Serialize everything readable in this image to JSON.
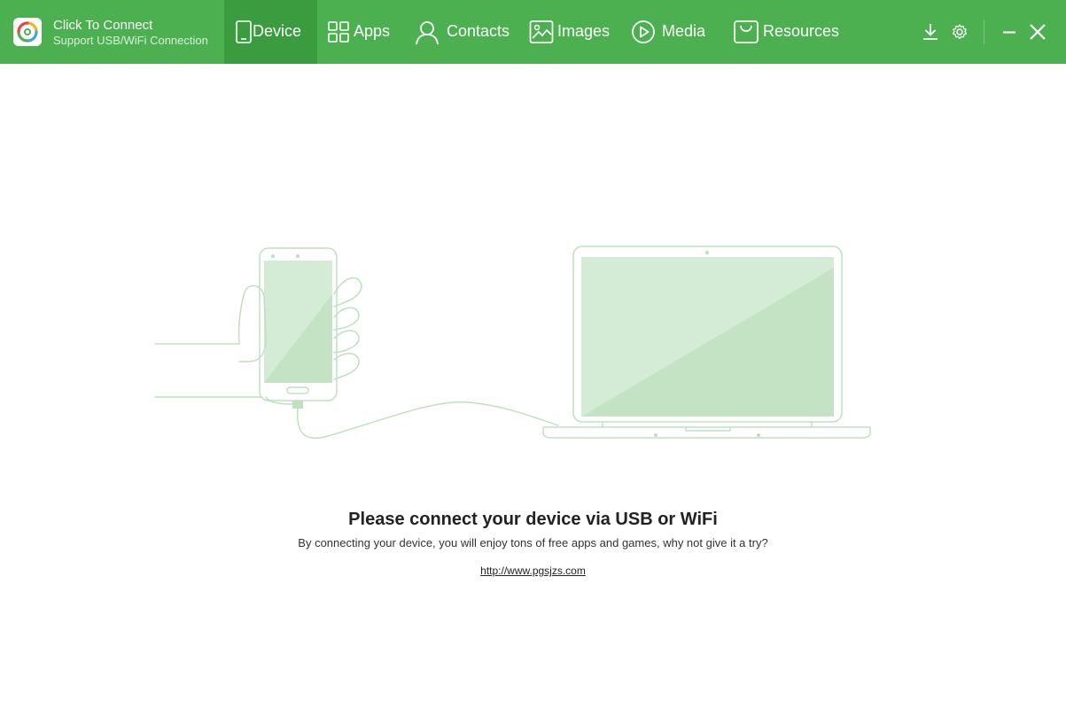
{
  "header": {
    "brand": {
      "title": "Click To Connect",
      "subtitle": "Support USB/WiFi Connection"
    },
    "tabs": [
      {
        "label": "Device",
        "icon": "phone-icon",
        "active": true
      },
      {
        "label": "Apps",
        "icon": "apps-grid-icon",
        "active": false
      },
      {
        "label": "Contacts",
        "icon": "contact-person-icon",
        "active": false
      },
      {
        "label": "Images",
        "icon": "image-icon",
        "active": false
      },
      {
        "label": "Media",
        "icon": "play-circle-icon",
        "active": false
      },
      {
        "label": "Resources",
        "icon": "shopping-bag-icon",
        "active": false
      }
    ],
    "window_controls": [
      "download-icon",
      "gear-icon",
      "minimize-icon",
      "close-icon"
    ]
  },
  "main": {
    "headline": "Please connect your device via USB or WiFi",
    "message": "By connecting your device, you will enjoy tons of free apps and games, why not give it a try?",
    "link": "http://www.pgsjzs.com"
  },
  "colors": {
    "header_bg": "#4cb050",
    "active_tab_bg": "#3a9b3f",
    "illustration_stroke": "#bfe0c0",
    "illustration_fill": "#d4ebd5"
  }
}
